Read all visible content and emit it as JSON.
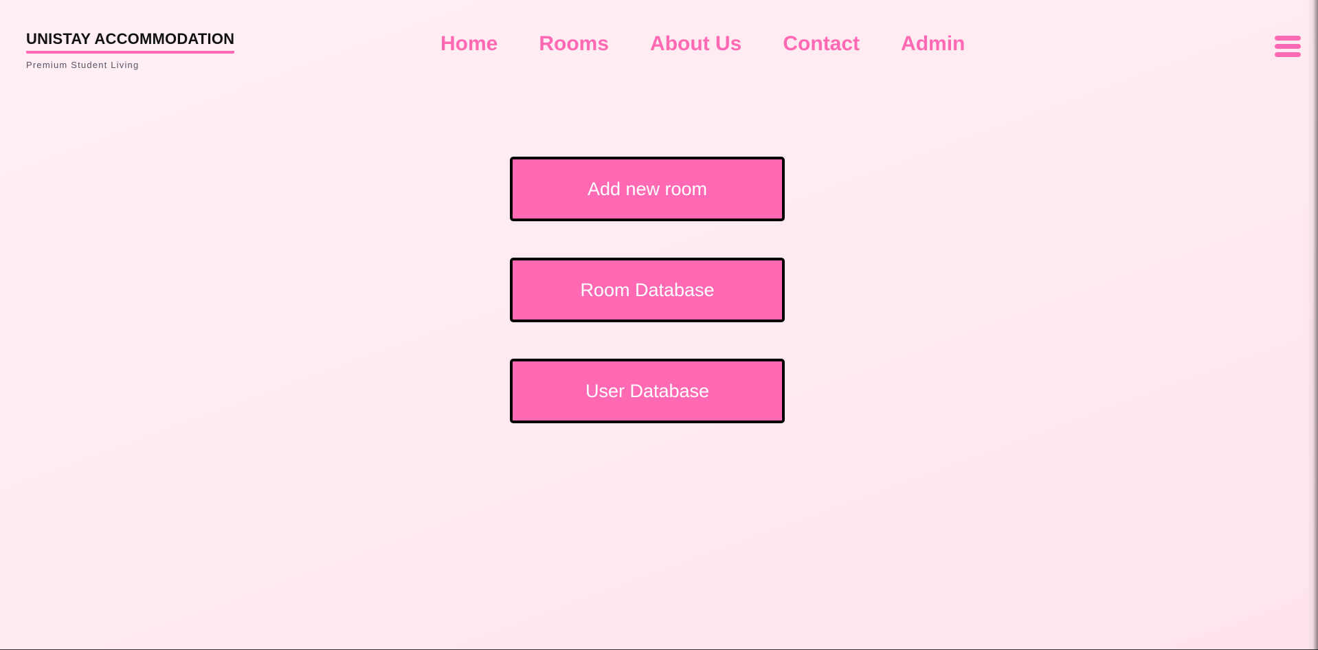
{
  "brand": {
    "title": "UNISTAY ACCOMMODATION",
    "subtitle": "Premium Student Living"
  },
  "nav": {
    "items": [
      {
        "label": "Home"
      },
      {
        "label": "Rooms"
      },
      {
        "label": "About Us"
      },
      {
        "label": "Contact"
      },
      {
        "label": "Admin"
      }
    ],
    "menu_icon": "hamburger-menu-icon"
  },
  "actions": {
    "add_room_label": "Add new room",
    "room_db_label": "Room Database",
    "user_db_label": "User Database"
  },
  "colors": {
    "accent": "#ff69b4",
    "background": "#ffeef3",
    "button_border": "#000000",
    "button_text": "#ffffff"
  }
}
